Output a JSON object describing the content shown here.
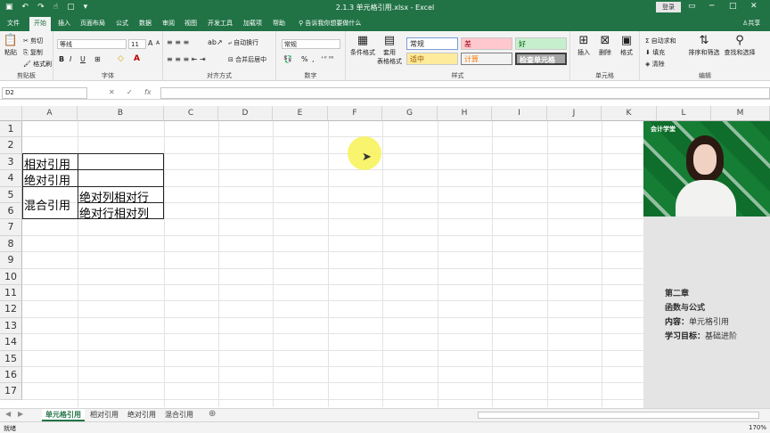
{
  "window": {
    "title": "2.1.3 单元格引用.xlsx - Excel",
    "login": "登录"
  },
  "tabs": [
    "文件",
    "开始",
    "插入",
    "页面布局",
    "公式",
    "数据",
    "审阅",
    "视图",
    "开发工具",
    "加载项",
    "帮助"
  ],
  "active_tab": "开始",
  "tell_me": "告诉我你想要做什么",
  "share": "共享",
  "ribbon": {
    "clipboard": {
      "label": "剪贴板",
      "paste": "粘贴",
      "cut": "剪切",
      "copy": "复制",
      "format_painter": "格式刷"
    },
    "font": {
      "label": "字体",
      "name": "等线",
      "size": "11",
      "bold": "B",
      "italic": "I",
      "underline": "U",
      "grow": "A",
      "shrink": "A",
      "fill_glyph": "◇",
      "color_glyph": "A"
    },
    "align": {
      "label": "对齐方式",
      "wrap": "自动换行",
      "merge": "合并后居中"
    },
    "number": {
      "label": "数字",
      "format": "常规",
      "percent": "%",
      "comma": ","
    },
    "styles": {
      "label": "样式",
      "conditional": "条件格式",
      "table": "套用",
      "table2": "表格格式",
      "items": [
        {
          "name": "常规",
          "bg": "#ffffff",
          "fg": "#000000",
          "border": "#7a9bd0"
        },
        {
          "name": "差",
          "bg": "#ffc7ce",
          "fg": "#9c0006",
          "border": "#e6b6bd"
        },
        {
          "name": "好",
          "bg": "#c6efce",
          "fg": "#006100",
          "border": "#b7dfbe"
        },
        {
          "name": "适中",
          "bg": "#ffeb9c",
          "fg": "#9c5700",
          "border": "#e8d88d"
        },
        {
          "name": "计算",
          "bg": "#f2f2f2",
          "fg": "#fa7d00",
          "border": "#7f7f7f"
        },
        {
          "name": "检查单元格",
          "bg": "#a5a5a5",
          "fg": "#ffffff",
          "border": "#3f3f3f"
        }
      ]
    },
    "cells": {
      "label": "单元格",
      "insert": "插入",
      "delete": "删除",
      "format": "格式"
    },
    "editing": {
      "label": "编辑",
      "autosum": "自动求和",
      "fill": "填充",
      "clear": "清除",
      "sort": "排序和筛选",
      "find": "查找和选择"
    }
  },
  "formula_bar": {
    "name_box": "D2",
    "cancel": "✕",
    "enter": "✓",
    "fx": "fx",
    "value": ""
  },
  "columns": [
    "A",
    "B",
    "C",
    "D",
    "E",
    "F",
    "G",
    "H",
    "I",
    "J",
    "K",
    "L",
    "M"
  ],
  "rows": [
    "1",
    "2",
    "3",
    "4",
    "5",
    "6",
    "7",
    "8",
    "9",
    "10",
    "11",
    "12",
    "13",
    "14",
    "15",
    "16",
    "17"
  ],
  "cells": {
    "A3": "相对引用",
    "A4": "绝对引用",
    "A5": "混合引用",
    "B5": "绝对列相对行",
    "B6": "绝对行相对列"
  },
  "sheets": [
    "单元格引用",
    "相对引用",
    "绝对引用",
    "混合引用"
  ],
  "active_sheet": "单元格引用",
  "status": {
    "mode": "就绪",
    "zoom": "170%"
  },
  "side_panel": {
    "chapter": "第二章",
    "subtitle": "函数与公式",
    "content_label": "内容：",
    "content": "单元格引用",
    "goal_label": "学习目标：",
    "goal": "基础进阶",
    "video_logo": "会计学堂"
  },
  "colors": {
    "excel_green": "#217346",
    "video_bg": "#0f6e2b",
    "pointer": "#f7f35e"
  }
}
